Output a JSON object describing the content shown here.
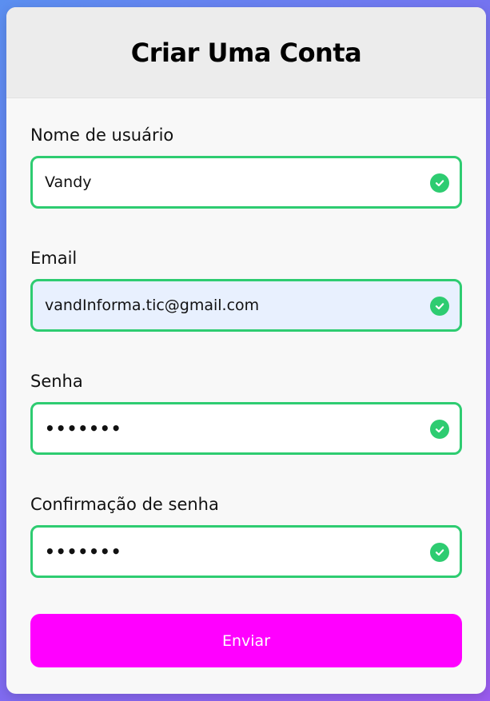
{
  "form": {
    "title": "Criar Uma Conta",
    "fields": [
      {
        "label": "Nome de usuário",
        "value": "Vandy",
        "type": "text",
        "status": "valid",
        "status_icon": "check-circle-icon"
      },
      {
        "label": "Email",
        "value": "vandInforma.tic@gmail.com",
        "type": "email",
        "status": "valid",
        "status_icon": "check-circle-icon"
      },
      {
        "label": "Senha",
        "value": "•••••••",
        "type": "password",
        "status": "valid",
        "status_icon": "check-circle-icon"
      },
      {
        "label": "Confirmação de senha",
        "value": "•••••••",
        "type": "password",
        "status": "valid",
        "status_icon": "check-circle-icon"
      }
    ],
    "submit_label": "Enviar"
  },
  "colors": {
    "valid": "#2ecc71",
    "button": "#ff00ff",
    "header_bg": "#ececec",
    "card_bg": "#f8f8f8",
    "autofill_bg": "#e8f0fe",
    "background_gradient": [
      "#5b8ff0",
      "#9b5cf0"
    ]
  }
}
